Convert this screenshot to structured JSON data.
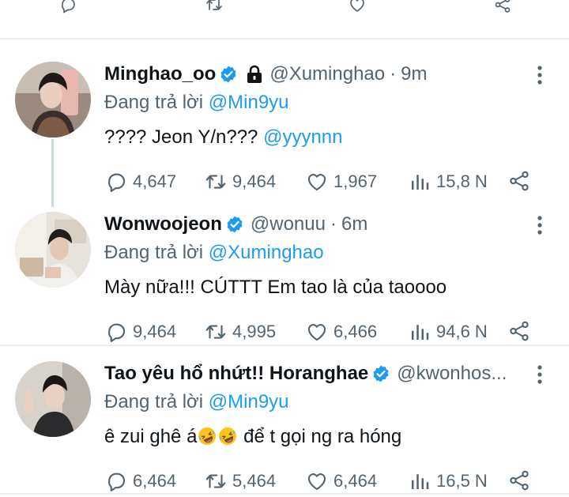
{
  "colors": {
    "accent": "#1d9bf0",
    "muted": "#536471",
    "text": "#0f1419",
    "divider": "#eceef0"
  },
  "top_actions": [
    {
      "icon": "reply-icon"
    },
    {
      "icon": "retweet-icon"
    },
    {
      "icon": "like-icon"
    },
    {
      "icon": "share-icon"
    }
  ],
  "tweets": [
    {
      "name": "Minghao_oo",
      "verified": true,
      "locked": true,
      "handle": "@Xuminghao",
      "dot": "·",
      "time": "9m",
      "reply_prefix": "Đang trả lời",
      "reply_to": "@Min9yu",
      "text": "???? Jeon Y/n???",
      "text_mention": "@yyynnn",
      "replies": "4,647",
      "retweets": "9,464",
      "likes": "1,967",
      "views": "15,8 N"
    },
    {
      "name": "Wonwoojeon",
      "verified": true,
      "handle": "@wonuu",
      "dot": "·",
      "time": "6m",
      "reply_prefix": "Đang trả lời",
      "reply_to": "@Xuminghao",
      "text": "Mày nữa!!! CÚTTT Em tao là của taoooo",
      "replies": "9,464",
      "retweets": "4,995",
      "likes": "6,466",
      "views": "94,6 N"
    },
    {
      "name": "Tao yêu hổ nhứt!! Horanghae",
      "verified": true,
      "handle": "@kwonhos...",
      "reply_prefix": "Đang trả lời",
      "reply_to": "@Min9yu",
      "text_before": "ê zui ghê á",
      "text_after": " để t gọi ng ra hóng",
      "emoji": "rolling-on-floor-laughing",
      "replies": "6,464",
      "retweets": "5,464",
      "likes": "6,464",
      "views": "16,5 N"
    }
  ]
}
